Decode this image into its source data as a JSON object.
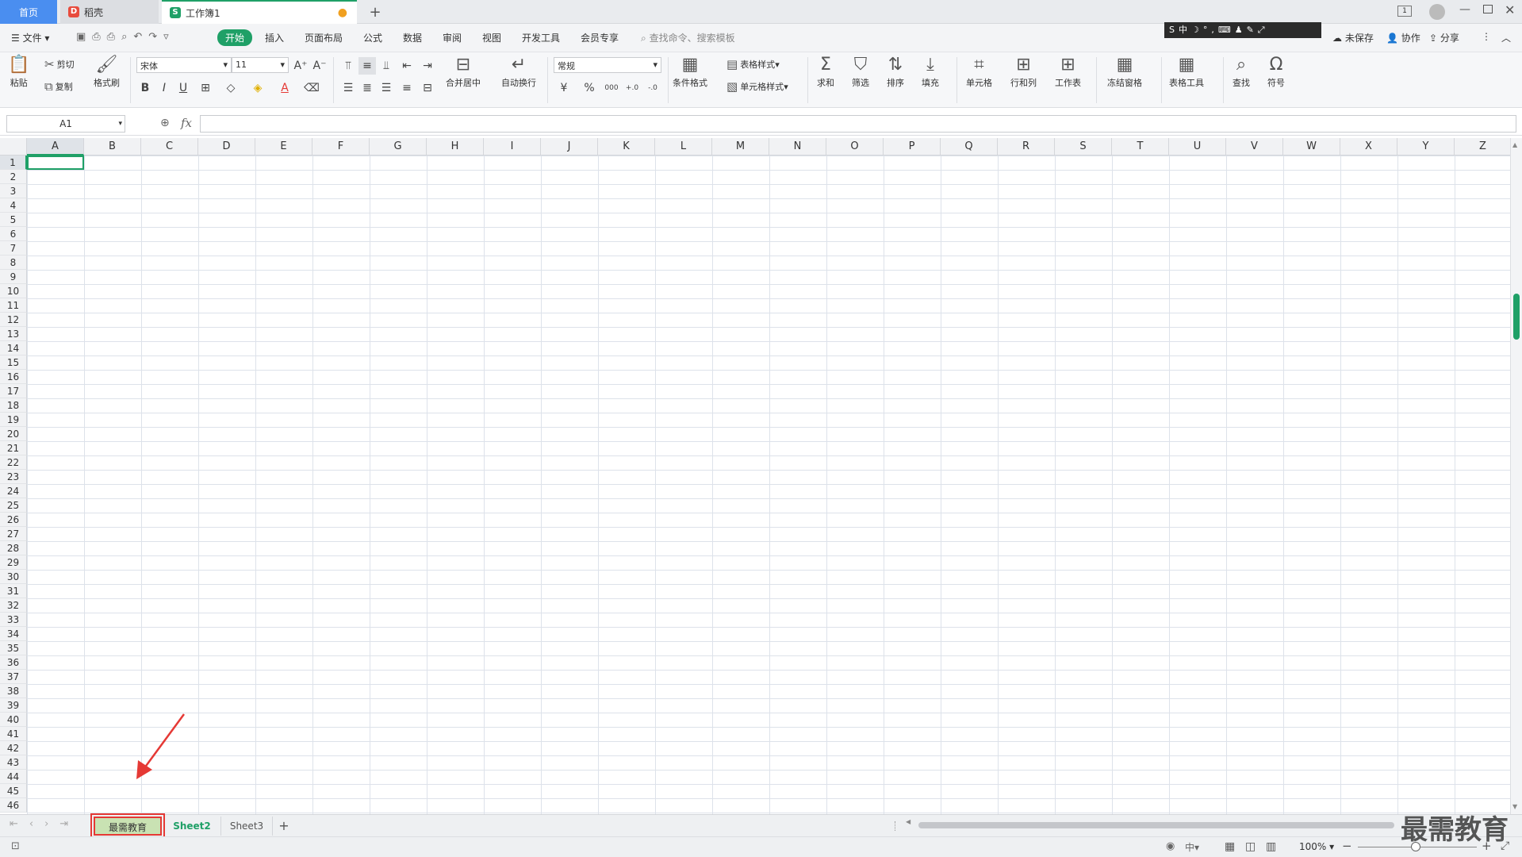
{
  "tabs": {
    "home": "首页",
    "wps": "稻壳",
    "workbook": "工作簿1"
  },
  "menu": {
    "file": "文件",
    "items": [
      "开始",
      "插入",
      "页面布局",
      "公式",
      "数据",
      "审阅",
      "视图",
      "开发工具",
      "会员专享"
    ],
    "search_placeholder": "查找命令、搜索模板",
    "unsaved": "未保存",
    "collab": "协作",
    "share": "分享"
  },
  "ribbon": {
    "paste": "粘贴",
    "cut": "剪切",
    "copy": "复制",
    "format_painter": "格式刷",
    "font_name": "宋体",
    "font_size": "11",
    "merge_center": "合并居中",
    "wrap_text": "自动换行",
    "number_format": "常规",
    "conditional_format": "条件格式",
    "table_style": "表格样式",
    "cell_style": "单元格样式",
    "sum": "求和",
    "filter": "筛选",
    "sort": "排序",
    "fill": "填充",
    "cell": "单元格",
    "row_col": "行和列",
    "worksheet": "工作表",
    "freeze": "冻结窗格",
    "table_tools": "表格工具",
    "find": "查找",
    "symbol": "符号",
    "currency": "¥",
    "percent": "%",
    "thousands": "000",
    "dec_inc": "+.0",
    "dec_dec": "-.0"
  },
  "formula": {
    "cell_ref": "A1",
    "fx": "fx"
  },
  "grid": {
    "columns": [
      "A",
      "B",
      "C",
      "D",
      "E",
      "F",
      "G",
      "H",
      "I",
      "J",
      "K",
      "L",
      "M",
      "N",
      "O",
      "P",
      "Q",
      "R",
      "S",
      "T",
      "U",
      "V",
      "W",
      "X",
      "Y",
      "Z"
    ],
    "row_count": 46
  },
  "sheets": [
    "最需教育",
    "Sheet2",
    "Sheet3"
  ],
  "status": {
    "zoom": "100%"
  },
  "watermark": "最需教育",
  "colors": {
    "accent": "#1fa067",
    "tab_blue": "#4a8ef0",
    "highlight_red": "#e53935",
    "selected_sheet_bg": "#c9e2b3"
  }
}
